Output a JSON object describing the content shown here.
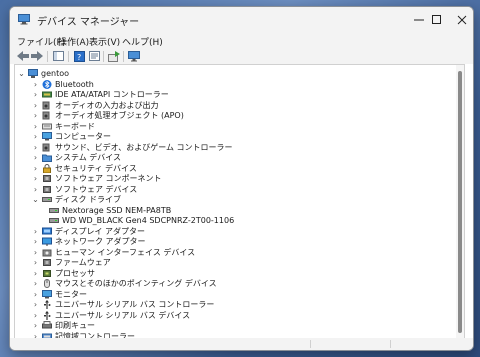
{
  "window": {
    "title": "デバイス マネージャー",
    "controls": {
      "minimize": "─",
      "maximize": "☐",
      "close": "✕"
    }
  },
  "menu": [
    "ファイル(F)",
    "操作(A)",
    "表示(V)",
    "ヘルプ(H)"
  ],
  "toolbar": [
    "back",
    "forward",
    "show-hide",
    "help",
    "properties",
    "update",
    "monitor"
  ],
  "tree": [
    {
      "label": "gentoo",
      "level": 0,
      "expanded": true,
      "icon": "computer"
    },
    {
      "label": "Bluetooth",
      "level": 1,
      "icon": "bluetooth"
    },
    {
      "label": "IDE ATA/ATAPI コントローラー",
      "level": 1,
      "icon": "ide"
    },
    {
      "label": "オーディオの入力および出力",
      "level": 1,
      "icon": "speaker"
    },
    {
      "label": "オーディオ処理オブジェクト (APO)",
      "level": 1,
      "icon": "speaker"
    },
    {
      "label": "キーボード",
      "level": 1,
      "icon": "keyboard"
    },
    {
      "label": "コンピューター",
      "level": 1,
      "icon": "monitor"
    },
    {
      "label": "サウンド、ビデオ、およびゲーム コントローラー",
      "level": 1,
      "icon": "speaker"
    },
    {
      "label": "システム デバイス",
      "level": 1,
      "icon": "folder"
    },
    {
      "label": "セキュリティ デバイス",
      "level": 1,
      "icon": "lock"
    },
    {
      "label": "ソフトウェア コンポーネント",
      "level": 1,
      "icon": "chip"
    },
    {
      "label": "ソフトウェア デバイス",
      "level": 1,
      "icon": "chip"
    },
    {
      "label": "ディスク ドライブ",
      "level": 1,
      "expanded": true,
      "icon": "drive"
    },
    {
      "label": "Nextorage SSD NEM-PA8TB",
      "level": 2,
      "icon": "drive"
    },
    {
      "label": "WD WD_BLACK Gen4 SDCPNRZ-2T00-1106",
      "level": 2,
      "icon": "drive"
    },
    {
      "label": "ディスプレイ アダプター",
      "level": 1,
      "icon": "display"
    },
    {
      "label": "ネットワーク アダプター",
      "level": 1,
      "icon": "network"
    },
    {
      "label": "ヒューマン インターフェイス デバイス",
      "level": 1,
      "icon": "hid"
    },
    {
      "label": "ファームウェア",
      "level": 1,
      "icon": "chip"
    },
    {
      "label": "プロセッサ",
      "level": 1,
      "icon": "cpu"
    },
    {
      "label": "マウスとそのほかのポインティング デバイス",
      "level": 1,
      "icon": "mouse"
    },
    {
      "label": "モニター",
      "level": 1,
      "icon": "monitor"
    },
    {
      "label": "ユニバーサル シリアル バス コントローラー",
      "level": 1,
      "icon": "usb"
    },
    {
      "label": "ユニバーサル シリアル バス デバイス",
      "level": 1,
      "icon": "usb"
    },
    {
      "label": "印刷キュー",
      "level": 1,
      "icon": "printer"
    },
    {
      "label": "記憶域コントローラー",
      "level": 1,
      "icon": "storage"
    }
  ]
}
